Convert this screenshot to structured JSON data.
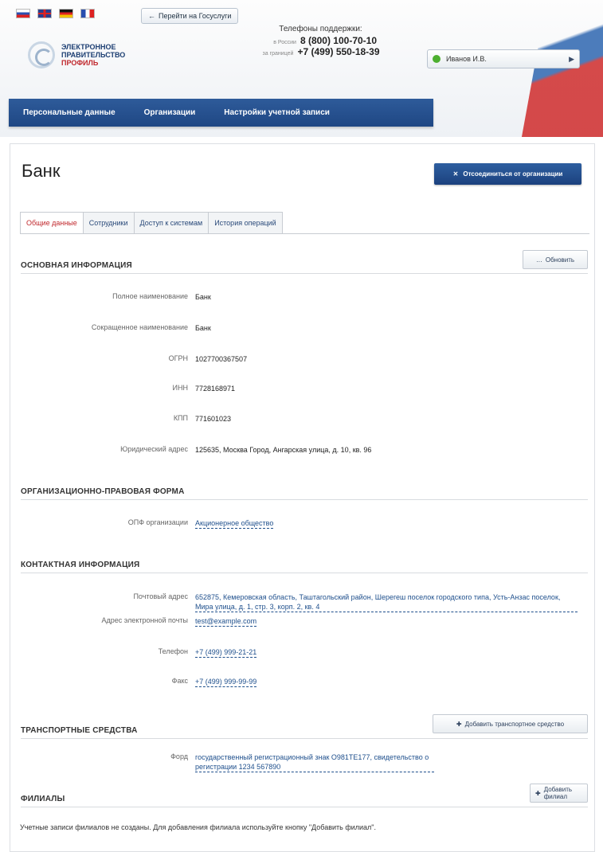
{
  "header": {
    "gos_link": "Перейти на Госуслуги",
    "logo": {
      "line1": "ЭЛЕКТРОННОЕ",
      "line2": "ПРАВИТЕЛЬСТВО",
      "line3": "ПРОФИЛЬ"
    },
    "support": {
      "caption": "Телефоны поддержки:",
      "rows": [
        {
          "label": "в России",
          "number": "8 (800) 100-70-10"
        },
        {
          "label": "за границей",
          "number": "+7 (499) 550-18-39"
        }
      ]
    },
    "user": {
      "name": "Иванов И.В."
    },
    "colors": {
      "brand": "#1f4784",
      "accent_red": "#c0282d",
      "online": "#4caf2f"
    }
  },
  "nav": {
    "items": [
      "Персональные данные",
      "Организации",
      "Настройки учетной записи"
    ]
  },
  "page": {
    "title": "Банк",
    "leave_button": "Отсоединиться от организации",
    "tabs": [
      "Общие данные",
      "Сотрудники",
      "Доступ к системам",
      "История операций"
    ],
    "active_tab": 0
  },
  "basic": {
    "heading": "ОСНОВНАЯ ИНФОРМАЦИЯ",
    "refresh_button": "Обновить",
    "fields": [
      {
        "label": "Полное наименование",
        "value": "Банк"
      },
      {
        "label": "Сокращенное наименование",
        "value": "Банк"
      },
      {
        "label": "ОГРН",
        "value": "1027700367507"
      },
      {
        "label": "ИНН",
        "value": "7728168971"
      },
      {
        "label": "КПП",
        "value": "771601023"
      },
      {
        "label": "Юридический адрес",
        "value": "125635, Москва Город, Ангарская улица, д. 10, кв. 96"
      }
    ]
  },
  "legal": {
    "heading": "ОРГАНИЗАЦИОННО-ПРАВОВАЯ ФОРМА",
    "field": {
      "label": "ОПФ организации",
      "value": "Акционерное общество"
    }
  },
  "contacts": {
    "heading": "КОНТАКТНАЯ ИНФОРМАЦИЯ",
    "fields": [
      {
        "label": "Почтовый адрес",
        "value": "652875, Кемеровская область, Таштагольский район, Шерегеш поселок городского типа, Усть-Анзас поселок, Мира улица, д. 1, стр. 3, корп. 2, кв. 4"
      },
      {
        "label": "Адрес электронной почты",
        "value": "test@example.com"
      },
      {
        "label": "Телефон",
        "value": "+7 (499) 999-21-21"
      },
      {
        "label": "Факс",
        "value": "+7 (499) 999-99-99"
      }
    ]
  },
  "vehicles": {
    "heading": "ТРАНСПОРТНЫЕ СРЕДСТВА",
    "add_button": "Добавить транспортное средство",
    "field": {
      "label": "Форд",
      "value": "государственный регистрационный знак О981ТЕ177, свидетельство о регистрации 1234 567890"
    }
  },
  "branches": {
    "heading": "ФИЛИАЛЫ",
    "add_button": "Добавить филиал",
    "note": "Учетные записи филиалов не созданы. Для добавления филиала используйте кнопку \"Добавить филиал\"."
  }
}
